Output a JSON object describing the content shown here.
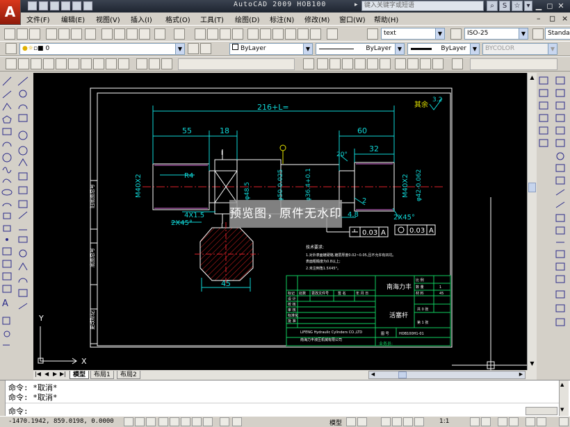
{
  "window": {
    "title": "AutoCAD 2009  HOB100",
    "search_placeholder": "键入关键字或短语",
    "logo": "A"
  },
  "menu": [
    "文件(F)",
    "编辑(E)",
    "视图(V)",
    "插入(I)",
    "格式(O)",
    "工具(T)",
    "绘图(D)",
    "标注(N)",
    "修改(M)",
    "窗口(W)",
    "帮助(H)"
  ],
  "styles_toolbar": {
    "text_style": "text",
    "dim_style": "ISO-25",
    "table_style": "Standar"
  },
  "layers_toolbar": {
    "layer_value": "0",
    "color": "ByLayer",
    "linetype": "ByLayer",
    "lineweight": "ByLayer",
    "plotstyle": "BYCOLOR"
  },
  "drawing": {
    "overall_dim": "216+L=",
    "dim_55": "55",
    "dim_18": "18",
    "dim_60": "60",
    "dim_32": "32",
    "dim_45": "45",
    "dim_4x15": "4X1.5",
    "dim_2x45_left": "2X45°",
    "dim_2x45_right": "2X45°",
    "dim_r4": "R4",
    "dim_20": "20°",
    "dim_2": "2",
    "dim_48": "4.8",
    "dim_m40_left": "M40X2",
    "dim_m40_right": "M40X2",
    "dim_d42": "φ42-0.062",
    "dim_d485": "φ48.5",
    "dim_d50": "φ50-0.025",
    "dim_d364": "φ36.4+0.1",
    "roughness_label": "其余",
    "roughness_value": "3.2",
    "section_label": "I",
    "tol_1": "0.03",
    "tol_1_ref": "A",
    "tol_2": "0.03",
    "tol_2_ref": "A",
    "datum": "A",
    "notes_title": "技术要求:",
    "note_1": "1.对外表面镀硬铬,镀层厚度0.02~0.05,且不允许有凹坑。",
    "note_2": "  表面粗糙度为0.8以上;",
    "note_3": "2.未注倒角1.5X45°。",
    "tb_company": "南海力丰",
    "tb_part": "活塞杆",
    "tb_code": "HOB100H1-01",
    "tb_company_full": "南海力丰液压机械有限公司",
    "tb_company_en": "LIFENG Hydraulic Cylinders CO.,LTD",
    "tb_page_1": "共 0 张",
    "tb_page_2": "第 1 张",
    "tb_draw_no_label": "图 号",
    "tb_material": "45",
    "tb_ratio": "1",
    "tb_row_labels": [
      "设 计",
      "校 核",
      "审 核",
      "标准化",
      "批 准"
    ],
    "tb_headers": [
      "标记",
      "处数",
      "更改文件号",
      "签 名",
      "年 月 日"
    ],
    "tb_right_labels": [
      "比 例",
      "数 量",
      "材 料"
    ],
    "tb_sidebar_1": "更改标记",
    "tb_sidebar_2": "旧底图总号",
    "tb_sidebar_3": "底图总号",
    "tb_caption": "业务员:",
    "axis_x": "X",
    "axis_y": "Y"
  },
  "watermark": "预览图，原件无水印",
  "layout_tabs": [
    "模型",
    "布局1",
    "布局2"
  ],
  "command": {
    "lines": [
      "命令: *取消*",
      "命令: *取消*"
    ],
    "prompt": "命令:"
  },
  "status": {
    "coords": "-1470.1942,  859.0198,  0.0000",
    "model": "模型",
    "scale": "1:1"
  }
}
